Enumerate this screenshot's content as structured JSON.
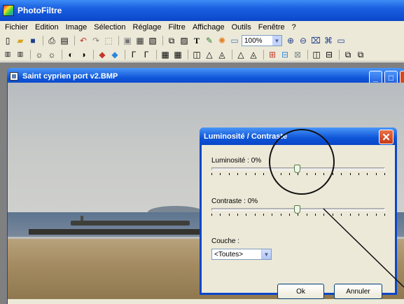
{
  "app": {
    "title": "PhotoFiltre"
  },
  "menu": [
    "Fichier",
    "Edition",
    "Image",
    "Sélection",
    "Réglage",
    "Filtre",
    "Affichage",
    "Outils",
    "Fenêtre",
    "?"
  ],
  "toolbar": {
    "zoom_value": "100%"
  },
  "document": {
    "title": "Saint cyprien port v2.BMP"
  },
  "dialog": {
    "title": "Luminosité / Contraste",
    "brightness_label": "Luminosité : 0%",
    "contrast_label": "Contraste : 0%",
    "brightness_value": 0,
    "contrast_value": 0,
    "channel_label": "Couche :",
    "channel_selected": "<Toutes>",
    "ok_label": "Ok",
    "cancel_label": "Annuler"
  },
  "colors": {
    "titlebar": "#0a47c9",
    "panel": "#ece9d8",
    "close": "#c63a15"
  }
}
